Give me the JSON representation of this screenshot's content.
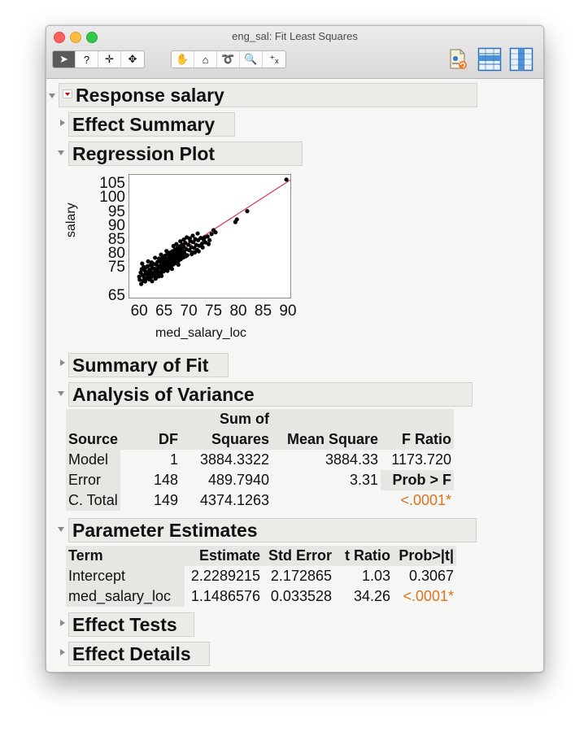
{
  "window": {
    "title": "eng_sal: Fit Least Squares"
  },
  "toolbar": {
    "group1": [
      {
        "icon": "arrow-pointer-icon",
        "glyph": "➤"
      },
      {
        "icon": "help-question-icon",
        "glyph": "?"
      },
      {
        "icon": "crosshair-icon",
        "glyph": "✛"
      },
      {
        "icon": "move-arrows-icon",
        "glyph": "✥"
      }
    ],
    "group2": [
      {
        "icon": "grabber-hand-icon",
        "glyph": "✋"
      },
      {
        "icon": "brush-icon",
        "glyph": "⌂"
      },
      {
        "icon": "lasso-icon",
        "glyph": "➰"
      },
      {
        "icon": "magnifier-icon",
        "glyph": "🔍"
      },
      {
        "icon": "annotate-icon",
        "glyph": "⁺ₓ"
      }
    ],
    "right_icons": [
      "script-icon",
      "table-rows-icon",
      "table-columns-icon"
    ]
  },
  "report": {
    "title": "Response salary",
    "sections": {
      "effect_summary": "Effect Summary",
      "regression_plot": "Regression Plot",
      "summary_of_fit": "Summary of Fit",
      "analysis_of_variance": "Analysis of Variance",
      "parameter_estimates": "Parameter Estimates",
      "effect_tests": "Effect Tests",
      "effect_details": "Effect Details"
    }
  },
  "anova": {
    "headers": {
      "source": "Source",
      "df": "DF",
      "ss_line1": "Sum of",
      "ss_line2": "Squares",
      "ms": "Mean Square",
      "f": "F Ratio",
      "probf": "Prob > F"
    },
    "rows": [
      {
        "source": "Model",
        "df": "1",
        "ss": "3884.3322",
        "ms": "3884.33",
        "f": "1173.720"
      },
      {
        "source": "Error",
        "df": "148",
        "ss": "489.7940",
        "ms": "3.31"
      },
      {
        "source": "C. Total",
        "df": "149",
        "ss": "4374.1263"
      }
    ],
    "prob_f": "<.0001*"
  },
  "parameters": {
    "headers": {
      "term": "Term",
      "estimate": "Estimate",
      "stderr": "Std Error",
      "t": "t Ratio",
      "p": "Prob>|t|"
    },
    "rows": [
      {
        "term": "Intercept",
        "estimate": "2.2289215",
        "stderr": "2.172865",
        "t": "1.03",
        "p": "0.3067"
      },
      {
        "term": "med_salary_loc",
        "estimate": "1.1486576",
        "stderr": "0.033528",
        "t": "34.26",
        "p": "<.0001*"
      }
    ]
  },
  "chart_data": {
    "type": "scatter",
    "xlabel": "med_salary_loc",
    "ylabel": "salary",
    "xlim": [
      58,
      90.5
    ],
    "ylim": [
      64,
      108
    ],
    "xticks": [
      "60",
      "65",
      "70",
      "75",
      "80",
      "85",
      "90"
    ],
    "yticks": [
      "65",
      "75",
      "80",
      "85",
      "90",
      "95",
      "100",
      "105"
    ],
    "fit_line": {
      "intercept": 2.2289215,
      "slope": 1.1486576,
      "color": "#d6336c"
    },
    "points": [
      [
        60.0,
        71.5
      ],
      [
        60.1,
        70.4
      ],
      [
        60.3,
        73.0
      ],
      [
        60.4,
        68.9
      ],
      [
        60.5,
        74.2
      ],
      [
        60.7,
        72.1
      ],
      [
        60.8,
        70.0
      ],
      [
        60.9,
        75.0
      ],
      [
        61.0,
        71.2
      ],
      [
        61.1,
        73.8
      ],
      [
        61.2,
        69.8
      ],
      [
        61.3,
        72.6
      ],
      [
        61.4,
        74.9
      ],
      [
        61.5,
        70.9
      ],
      [
        61.6,
        72.9
      ],
      [
        61.7,
        75.3
      ],
      [
        61.8,
        71.7
      ],
      [
        61.9,
        73.4
      ],
      [
        62.0,
        70.6
      ],
      [
        62.1,
        74.0
      ],
      [
        62.2,
        72.2
      ],
      [
        62.3,
        75.6
      ],
      [
        62.4,
        71.4
      ],
      [
        62.5,
        73.1
      ],
      [
        62.6,
        69.9
      ],
      [
        62.7,
        74.6
      ],
      [
        62.8,
        72.4
      ],
      [
        62.9,
        76.1
      ],
      [
        63.0,
        71.9
      ],
      [
        63.1,
        74.3
      ],
      [
        63.2,
        73.0
      ],
      [
        63.3,
        70.8
      ],
      [
        63.4,
        75.9
      ],
      [
        63.5,
        73.7
      ],
      [
        63.6,
        72.3
      ],
      [
        63.7,
        76.8
      ],
      [
        63.8,
        74.5
      ],
      [
        63.9,
        71.6
      ],
      [
        64.0,
        75.3
      ],
      [
        64.1,
        73.1
      ],
      [
        64.2,
        77.2
      ],
      [
        64.3,
        74.9
      ],
      [
        64.4,
        72.8
      ],
      [
        64.5,
        76.4
      ],
      [
        64.6,
        74.0
      ],
      [
        64.7,
        78.1
      ],
      [
        64.8,
        75.6
      ],
      [
        64.9,
        73.4
      ],
      [
        65.0,
        77.0
      ],
      [
        65.1,
        74.7
      ],
      [
        65.2,
        79.0
      ],
      [
        65.3,
        76.3
      ],
      [
        65.4,
        73.9
      ],
      [
        65.5,
        77.8
      ],
      [
        65.6,
        75.4
      ],
      [
        65.7,
        79.6
      ],
      [
        65.8,
        76.9
      ],
      [
        65.9,
        74.6
      ],
      [
        66.0,
        78.3
      ],
      [
        66.1,
        76.0
      ],
      [
        66.2,
        80.1
      ],
      [
        66.3,
        77.5
      ],
      [
        66.4,
        75.2
      ],
      [
        66.5,
        79.0
      ],
      [
        66.6,
        76.7
      ],
      [
        66.7,
        80.6
      ],
      [
        66.8,
        78.2
      ],
      [
        66.9,
        75.9
      ],
      [
        67.0,
        79.6
      ],
      [
        67.1,
        77.3
      ],
      [
        67.2,
        81.2
      ],
      [
        67.3,
        78.8
      ],
      [
        67.4,
        76.4
      ],
      [
        67.5,
        80.3
      ],
      [
        67.6,
        78.0
      ],
      [
        67.7,
        81.8
      ],
      [
        67.8,
        79.4
      ],
      [
        67.9,
        77.1
      ],
      [
        68.0,
        81.0
      ],
      [
        68.1,
        78.6
      ],
      [
        68.2,
        82.4
      ],
      [
        68.3,
        80.1
      ],
      [
        68.4,
        77.8
      ],
      [
        68.5,
        81.6
      ],
      [
        68.6,
        79.3
      ],
      [
        68.7,
        83.0
      ],
      [
        68.8,
        80.7
      ],
      [
        68.9,
        78.4
      ],
      [
        69.0,
        82.2
      ],
      [
        69.1,
        80.0
      ],
      [
        69.3,
        83.6
      ],
      [
        69.5,
        81.3
      ],
      [
        69.7,
        79.2
      ],
      [
        69.9,
        83.0
      ],
      [
        70.1,
        81.0
      ],
      [
        70.3,
        84.3
      ],
      [
        70.5,
        82.1
      ],
      [
        70.7,
        80.2
      ],
      [
        70.9,
        83.9
      ],
      [
        71.1,
        81.8
      ],
      [
        71.3,
        85.0
      ],
      [
        71.5,
        82.9
      ],
      [
        71.7,
        81.1
      ],
      [
        71.9,
        84.6
      ],
      [
        72.1,
        82.6
      ],
      [
        72.4,
        85.4
      ],
      [
        72.7,
        83.4
      ],
      [
        73.0,
        84.8
      ],
      [
        73.4,
        83.8
      ],
      [
        73.8,
        85.9
      ],
      [
        74.2,
        84.6
      ],
      [
        74.6,
        86.8
      ],
      [
        75.0,
        88.2
      ],
      [
        75.4,
        87.4
      ],
      [
        79.4,
        91.1
      ],
      [
        79.7,
        92.0
      ],
      [
        81.8,
        95.0
      ],
      [
        89.7,
        106.3
      ],
      [
        61.1,
        70.2
      ],
      [
        62.6,
        71.6
      ],
      [
        63.4,
        72.0
      ],
      [
        64.5,
        71.8
      ],
      [
        65.7,
        73.6
      ],
      [
        66.6,
        74.3
      ],
      [
        67.9,
        75.8
      ],
      [
        69.4,
        78.8
      ],
      [
        70.6,
        79.6
      ],
      [
        72.0,
        80.6
      ],
      [
        60.6,
        76.2
      ],
      [
        61.8,
        77.0
      ],
      [
        63.2,
        78.3
      ],
      [
        64.4,
        79.4
      ],
      [
        65.5,
        80.7
      ],
      [
        66.9,
        82.5
      ],
      [
        68.3,
        84.2
      ],
      [
        69.6,
        85.6
      ],
      [
        70.8,
        86.2
      ],
      [
        71.8,
        87.0
      ],
      [
        62.5,
        76.6
      ],
      [
        64.0,
        78.0
      ],
      [
        65.9,
        79.8
      ],
      [
        67.5,
        83.2
      ],
      [
        69.0,
        84.8
      ],
      [
        70.2,
        85.2
      ],
      [
        71.2,
        80.2
      ],
      [
        72.8,
        82.0
      ],
      [
        73.2,
        85.6
      ],
      [
        74.0,
        83.2
      ]
    ]
  }
}
